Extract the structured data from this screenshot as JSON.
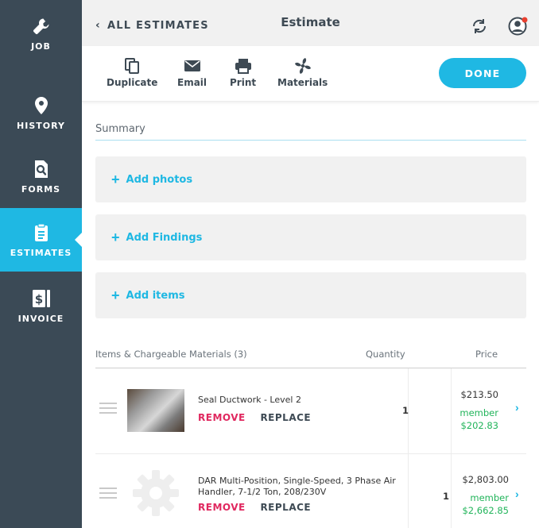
{
  "colors": {
    "sidebar_bg": "#3b4a56",
    "accent": "#1fb8e3",
    "remove": "#e0285f",
    "member": "#21b45a",
    "card_bg": "#f1f1f1"
  },
  "sidebar": {
    "items": [
      {
        "label": "JOB",
        "icon": "wrench-icon"
      },
      {
        "label": "HISTORY",
        "icon": "location-pin-icon"
      },
      {
        "label": "FORMS",
        "icon": "search-document-icon"
      },
      {
        "label": "ESTIMATES",
        "icon": "clipboard-icon",
        "active": true
      },
      {
        "label": "INVOICE",
        "icon": "dollar-invoice-icon"
      }
    ]
  },
  "header": {
    "back_label": "ALL ESTIMATES",
    "title": "Estimate",
    "sync_icon": "sync-icon",
    "profile_icon": "profile-icon"
  },
  "toolbar": {
    "duplicate_label": "Duplicate",
    "email_label": "Email",
    "print_label": "Print",
    "materials_label": "Materials",
    "done_label": "DONE"
  },
  "summary": {
    "label": "Summary"
  },
  "add_cards": {
    "photos": "Add photos",
    "findings": "Add Findings",
    "items": "Add items"
  },
  "items_table": {
    "header_items": "Items & Chargeable Materials (3)",
    "header_quantity": "Quantity",
    "header_price": "Price",
    "remove_label": "REMOVE",
    "replace_label": "REPLACE",
    "rows": [
      {
        "name": "Seal Ductwork - Level 2",
        "quantity": "1",
        "price": "$213.50",
        "member_label": "member",
        "member_price": "$202.83"
      },
      {
        "name_line1": "DAR Multi-Position, Single-Speed, 3 Phase Air",
        "name_line2": "Handler, 7-1/2 Ton, 208/230V",
        "quantity": "1",
        "price": "$2,803.00",
        "member_label": "member",
        "member_price": "$2,662.85"
      }
    ]
  }
}
